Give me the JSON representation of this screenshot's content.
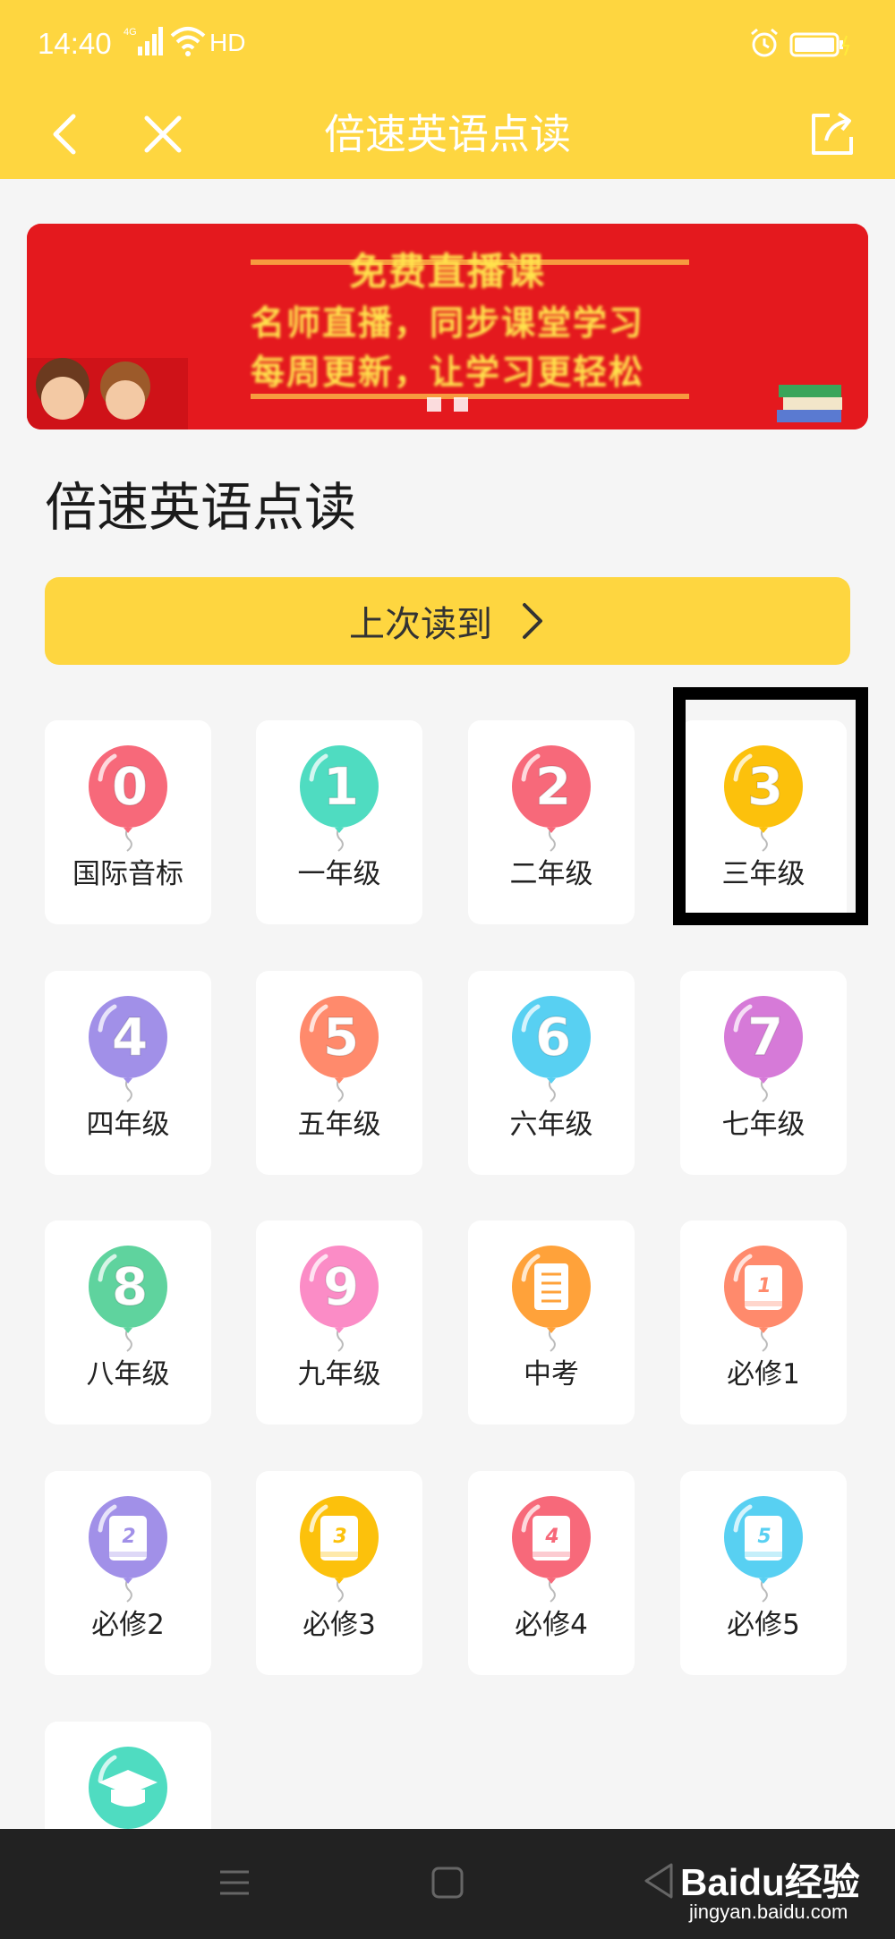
{
  "status_bar": {
    "time": "14:40",
    "network": "4G",
    "hd": "HD"
  },
  "nav": {
    "title": "倍速英语点读"
  },
  "banner": {
    "line1": "免费直播课",
    "line2": "名师直播，同步课堂学习",
    "line3": "每周更新，让学习更轻松"
  },
  "section": {
    "title": "倍速英语点读"
  },
  "continue": {
    "label": "上次读到"
  },
  "grades": [
    {
      "label": "国际音标",
      "badge": "0",
      "color": "#f7697a",
      "icon": "number"
    },
    {
      "label": "一年级",
      "badge": "1",
      "color": "#4fdcc1",
      "icon": "number"
    },
    {
      "label": "二年级",
      "badge": "2",
      "color": "#f7697a",
      "icon": "number"
    },
    {
      "label": "三年级",
      "badge": "3",
      "color": "#fcc10c",
      "icon": "number"
    },
    {
      "label": "四年级",
      "badge": "4",
      "color": "#a190e8",
      "icon": "number"
    },
    {
      "label": "五年级",
      "badge": "5",
      "color": "#ff8a6c",
      "icon": "number"
    },
    {
      "label": "六年级",
      "badge": "6",
      "color": "#58d0f2",
      "icon": "number"
    },
    {
      "label": "七年级",
      "badge": "7",
      "color": "#d67ad8",
      "icon": "number"
    },
    {
      "label": "八年级",
      "badge": "8",
      "color": "#5fd39e",
      "icon": "number"
    },
    {
      "label": "九年级",
      "badge": "9",
      "color": "#fb8cc6",
      "icon": "number"
    },
    {
      "label": "中考",
      "badge": "",
      "color": "#ffa23a",
      "icon": "document"
    },
    {
      "label": "必修1",
      "badge": "1",
      "color": "#ff8a6c",
      "icon": "book"
    },
    {
      "label": "必修2",
      "badge": "2",
      "color": "#a190e8",
      "icon": "book"
    },
    {
      "label": "必修3",
      "badge": "3",
      "color": "#fcc10c",
      "icon": "book"
    },
    {
      "label": "必修4",
      "badge": "4",
      "color": "#f7697a",
      "icon": "book"
    },
    {
      "label": "必修5",
      "badge": "5",
      "color": "#58d0f2",
      "icon": "book"
    },
    {
      "label": "",
      "badge": "",
      "color": "#4fdcc1",
      "icon": "graduation-cap"
    }
  ],
  "watermark": {
    "text": "Baidu经验",
    "url": "jingyan.baidu.com"
  }
}
